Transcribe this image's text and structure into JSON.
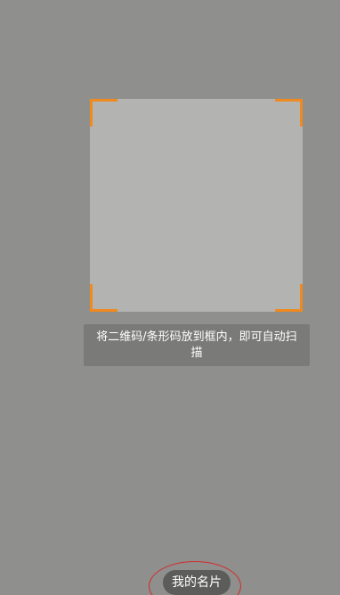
{
  "scanner": {
    "hint_text": "将二维码/条形码放到框内，即可自动扫描"
  },
  "bottom": {
    "my_card_label": "我的名片"
  },
  "colors": {
    "background": "#8f8f8d",
    "scan_area": "#b3b3b1",
    "corner_accent": "#f08a1e",
    "annotation": "#d32a2a"
  }
}
